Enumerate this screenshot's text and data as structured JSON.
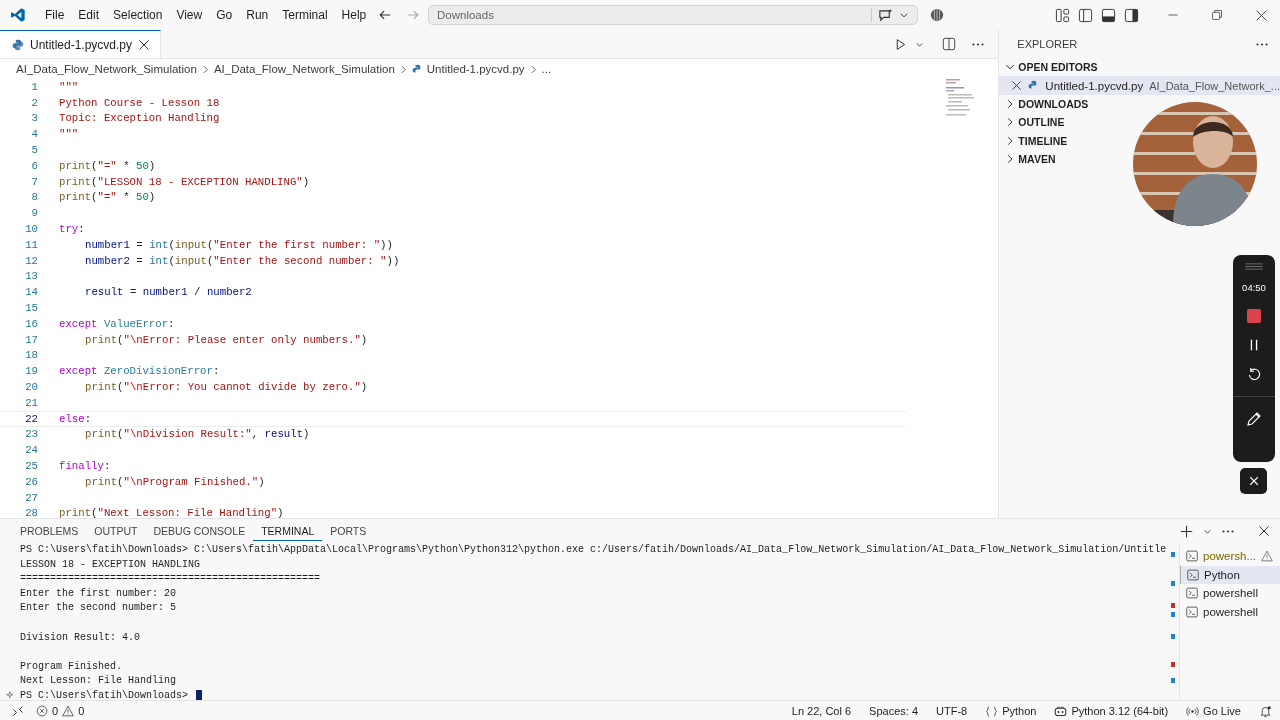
{
  "menu": [
    "File",
    "Edit",
    "Selection",
    "View",
    "Go",
    "Run",
    "Terminal",
    "Help"
  ],
  "command_center": {
    "value": "Downloads"
  },
  "editor_tabs": [
    {
      "label": "Untitled-1.pycvd.py",
      "selected": true
    }
  ],
  "breadcrumbs": [
    "AI_Data_Flow_Network_Simulation",
    "AI_Data_Flow_Network_Simulation",
    "Untitled-1.pycvd.py",
    "..."
  ],
  "editor": {
    "lines": [
      {
        "number": "1",
        "current": false,
        "indent": false,
        "tokens": [
          {
            "kind": "string",
            "text": "\"\"\""
          }
        ]
      },
      {
        "number": "2",
        "current": false,
        "indent": false,
        "tokens": [
          {
            "kind": "string",
            "text": "Python Course - Lesson 18"
          }
        ]
      },
      {
        "number": "3",
        "current": false,
        "indent": false,
        "tokens": [
          {
            "kind": "string",
            "text": "Topic: Exception Handling"
          }
        ]
      },
      {
        "number": "4",
        "current": false,
        "indent": false,
        "tokens": [
          {
            "kind": "string",
            "text": "\"\"\""
          }
        ]
      },
      {
        "number": "5",
        "current": false
      },
      {
        "number": "6",
        "current": false,
        "indent": false,
        "tokens": [
          {
            "kind": "func",
            "text": "print"
          },
          {
            "kind": "plain",
            "text": "("
          },
          {
            "kind": "string",
            "text": "\"=\""
          },
          {
            "kind": "plain",
            "text": " * "
          },
          {
            "kind": "number",
            "text": "50"
          },
          {
            "kind": "plain",
            "text": ")"
          }
        ]
      },
      {
        "number": "7",
        "current": false,
        "indent": false,
        "tokens": [
          {
            "kind": "func",
            "text": "print"
          },
          {
            "kind": "plain",
            "text": "("
          },
          {
            "kind": "string",
            "text": "\"LESSON 18 - EXCEPTION HANDLING\""
          },
          {
            "kind": "plain",
            "text": ")"
          }
        ]
      },
      {
        "number": "8",
        "current": false,
        "indent": false,
        "tokens": [
          {
            "kind": "func",
            "text": "print"
          },
          {
            "kind": "plain",
            "text": "("
          },
          {
            "kind": "string",
            "text": "\"=\""
          },
          {
            "kind": "plain",
            "text": " * "
          },
          {
            "kind": "number",
            "text": "50"
          },
          {
            "kind": "plain",
            "text": ")"
          }
        ]
      },
      {
        "number": "9",
        "current": false
      },
      {
        "number": "10",
        "current": false,
        "indent": false,
        "tokens": [
          {
            "kind": "keyword",
            "text": "try"
          },
          {
            "kind": "plain",
            "text": ":"
          }
        ]
      },
      {
        "number": "11",
        "current": false,
        "indent": true,
        "tokens": [
          {
            "kind": "var",
            "text": "number1"
          },
          {
            "kind": "plain",
            "text": " = "
          },
          {
            "kind": "class",
            "text": "int"
          },
          {
            "kind": "plain",
            "text": "("
          },
          {
            "kind": "func",
            "text": "input"
          },
          {
            "kind": "plain",
            "text": "("
          },
          {
            "kind": "string",
            "text": "\"Enter the first number: \""
          },
          {
            "kind": "plain",
            "text": "))"
          }
        ]
      },
      {
        "number": "12",
        "current": false,
        "indent": true,
        "tokens": [
          {
            "kind": "var",
            "text": "number2"
          },
          {
            "kind": "plain",
            "text": " = "
          },
          {
            "kind": "class",
            "text": "int"
          },
          {
            "kind": "plain",
            "text": "("
          },
          {
            "kind": "func",
            "text": "input"
          },
          {
            "kind": "plain",
            "text": "("
          },
          {
            "kind": "string",
            "text": "\"Enter the second number: \""
          },
          {
            "kind": "plain",
            "text": "))"
          }
        ]
      },
      {
        "number": "13",
        "current": false
      },
      {
        "number": "14",
        "current": false,
        "indent": true,
        "tokens": [
          {
            "kind": "var",
            "text": "result"
          },
          {
            "kind": "plain",
            "text": " = "
          },
          {
            "kind": "var",
            "text": "number1"
          },
          {
            "kind": "plain",
            "text": " / "
          },
          {
            "kind": "var",
            "text": "number2"
          }
        ]
      },
      {
        "number": "15",
        "current": false
      },
      {
        "number": "16",
        "current": false,
        "indent": false,
        "tokens": [
          {
            "kind": "keyword",
            "text": "except "
          },
          {
            "kind": "class",
            "text": "ValueError"
          },
          {
            "kind": "plain",
            "text": ":"
          }
        ]
      },
      {
        "number": "17",
        "current": false,
        "indent": true,
        "tokens": [
          {
            "kind": "func",
            "text": "print"
          },
          {
            "kind": "plain",
            "text": "("
          },
          {
            "kind": "string",
            "text": "\""
          },
          {
            "kind": "escape",
            "text": "\\n"
          },
          {
            "kind": "string",
            "text": "Error: Please enter only numbers.\""
          },
          {
            "kind": "plain",
            "text": ")"
          }
        ]
      },
      {
        "number": "18",
        "current": false
      },
      {
        "number": "19",
        "current": false,
        "indent": false,
        "tokens": [
          {
            "kind": "keyword",
            "text": "except "
          },
          {
            "kind": "class",
            "text": "ZeroDivisionError"
          },
          {
            "kind": "plain",
            "text": ":"
          }
        ]
      },
      {
        "number": "20",
        "current": false,
        "indent": true,
        "tokens": [
          {
            "kind": "func",
            "text": "print"
          },
          {
            "kind": "plain",
            "text": "("
          },
          {
            "kind": "string",
            "text": "\""
          },
          {
            "kind": "escape",
            "text": "\\n"
          },
          {
            "kind": "string",
            "text": "Error: You cannot divide by zero.\""
          },
          {
            "kind": "plain",
            "text": ")"
          }
        ]
      },
      {
        "number": "21",
        "current": false
      },
      {
        "number": "22",
        "current": true,
        "indent": false,
        "tokens": [
          {
            "kind": "keyword",
            "text": "else"
          },
          {
            "kind": "plain",
            "text": ":"
          }
        ]
      },
      {
        "number": "23",
        "current": false,
        "indent": true,
        "tokens": [
          {
            "kind": "func",
            "text": "print"
          },
          {
            "kind": "plain",
            "text": "("
          },
          {
            "kind": "string",
            "text": "\""
          },
          {
            "kind": "escape",
            "text": "\\n"
          },
          {
            "kind": "string",
            "text": "Division Result:\""
          },
          {
            "kind": "plain",
            "text": ", "
          },
          {
            "kind": "var",
            "text": "result"
          },
          {
            "kind": "plain",
            "text": ")"
          }
        ]
      },
      {
        "number": "24",
        "current": false
      },
      {
        "number": "25",
        "current": false,
        "indent": false,
        "tokens": [
          {
            "kind": "keyword",
            "text": "finally"
          },
          {
            "kind": "plain",
            "text": ":"
          }
        ]
      },
      {
        "number": "26",
        "current": false,
        "indent": true,
        "tokens": [
          {
            "kind": "func",
            "text": "print"
          },
          {
            "kind": "plain",
            "text": "("
          },
          {
            "kind": "string",
            "text": "\""
          },
          {
            "kind": "escape",
            "text": "\\n"
          },
          {
            "kind": "string",
            "text": "Program Finished.\""
          },
          {
            "kind": "plain",
            "text": ")"
          }
        ]
      },
      {
        "number": "27",
        "current": false
      },
      {
        "number": "28",
        "current": false,
        "indent": false,
        "tokens": [
          {
            "kind": "func",
            "text": "print"
          },
          {
            "kind": "plain",
            "text": "("
          },
          {
            "kind": "string",
            "text": "\"Next Lesson: File Handling\""
          },
          {
            "kind": "plain",
            "text": ")"
          }
        ]
      }
    ]
  },
  "explorer": {
    "title": "EXPLORER",
    "sections": [
      {
        "label": "OPEN EDITORS",
        "expanded": true,
        "items": [
          {
            "name": "Untitled-1.pycvd.py",
            "path": "AI_Data_Flow_Network_..."
          }
        ]
      },
      {
        "label": "DOWNLOADS",
        "expanded": false
      },
      {
        "label": "OUTLINE",
        "expanded": false
      },
      {
        "label": "TIMELINE",
        "expanded": false
      },
      {
        "label": "MAVEN",
        "expanded": false
      }
    ]
  },
  "webcam": {
    "kind": "picture"
  },
  "recorder": {
    "timer": "04:50"
  },
  "panel": {
    "tabs": [
      {
        "label": "PROBLEMS",
        "selected": false
      },
      {
        "label": "OUTPUT",
        "selected": false
      },
      {
        "label": "DEBUG CONSOLE",
        "selected": false
      },
      {
        "label": "TERMINAL",
        "selected": true
      },
      {
        "label": "PORTS",
        "selected": false
      }
    ],
    "terminal_blocks": [
      [
        "PS C:\\Users\\fatih\\Downloads> C:\\Users\\fatih\\AppData\\Local\\Programs\\Python\\Python312\\python.exe c:/Users/fatih/Downloads/AI_Data_Flow_Network_Simulation/AI_Data_Flow_Network_Simulation/Untitle",
        "LESSON 18 - EXCEPTION HANDLING",
        "==================================================",
        "Enter the first number: 20",
        "Enter the second number: 5"
      ],
      [
        "Division Result: 4.0"
      ],
      [
        "Program Finished.",
        "Next Lesson: File Handling"
      ]
    ],
    "prompt": "PS C:\\Users\\fatih\\Downloads>",
    "terminals": [
      {
        "label": "powersh...",
        "selected": false,
        "warning": true
      },
      {
        "label": "Python",
        "selected": true,
        "warning": false
      },
      {
        "label": "powershell",
        "selected": false,
        "warning": false
      },
      {
        "label": "powershell",
        "selected": false,
        "warning": false
      }
    ]
  },
  "status_bar": {
    "errors": "0",
    "warnings": "0",
    "items": [
      {
        "text": "Ln 22, Col 6",
        "kind": "position"
      },
      {
        "text": "Spaces: 4",
        "kind": "indentation"
      },
      {
        "text": "UTF-8",
        "kind": "encoding"
      },
      {
        "text": "Python",
        "kind": "language"
      },
      {
        "text": "Python 3.12 (64-bit)",
        "kind": "interpreter"
      },
      {
        "text": "Go Live",
        "kind": "live"
      }
    ]
  }
}
